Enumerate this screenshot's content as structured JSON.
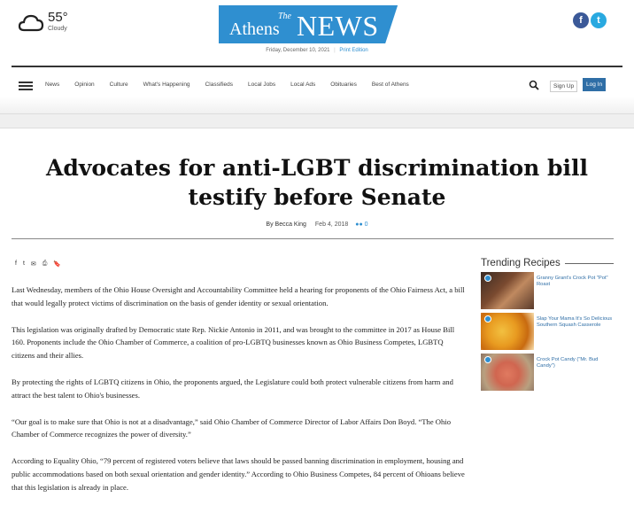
{
  "weather": {
    "temperature": "55°",
    "condition": "Cloudy",
    "icon": "cloud-icon"
  },
  "logo": {
    "the": "The",
    "athens": "Athens",
    "news": "NEWS"
  },
  "social": {
    "facebook_glyph": "f",
    "twitter_glyph": "t"
  },
  "dateline": {
    "date": "Friday, December 10, 2021",
    "separator": "|",
    "print_edition": "Print Edition"
  },
  "nav": {
    "items": [
      "News",
      "Opinion",
      "Culture",
      "What's Happening",
      "Classifieds",
      "Local Jobs",
      "Local Ads",
      "Obituaries",
      "Best of Athens"
    ],
    "signup": "Sign Up",
    "login": "Log In"
  },
  "article": {
    "headline_line1": "Advocates for anti-LGBT discrimination bill",
    "headline_line2": "testify before Senate",
    "byline": "By Becca King",
    "date": "Feb 4, 2018",
    "comments": "0",
    "tools": [
      "f",
      "t",
      "✉",
      "⎙",
      "🔖"
    ],
    "paragraphs": [
      "Last Wednesday, members of the Ohio House Oversight and Accountability Committee held a hearing for proponents of the Ohio Fairness Act, a bill that would legally protect victims of discrimination on the basis of gender identity or sexual orientation.",
      "This legislation was originally drafted by Democratic state Rep. Nickie Antonio in 2011, and was brought to the committee in 2017 as House Bill 160.  Proponents include the Ohio Chamber of Commerce, a coalition of pro-LGBTQ businesses known as Ohio Business Competes, LGBTQ citizens and their allies.",
      "By protecting the rights of LGBTQ citizens in Ohio, the proponents argued, the Legislature could both protect vulnerable citizens from harm and attract the best talent to Ohio's businesses.",
      "“Our goal is to make sure that Ohio is not at a disadvantage,” said Ohio Chamber of Commerce Director of Labor Affairs Don Boyd.  “The Ohio Chamber of Commerce recognizes the power of diversity.”",
      "According to Equality Ohio, “79 percent of registered voters believe that laws should be passed banning discrimination in employment, housing and public accommodations based on both sexual orientation and gender identity.”  According to Ohio Business Competes, 84 percent of Ohioans believe that this legislation is already in place."
    ]
  },
  "trending": {
    "title": "Trending Recipes",
    "items": [
      {
        "caption": "Granny Grant's Crock Pot \"Pot\" Roast"
      },
      {
        "caption": "Slap Your Mama It's So Delicious Southern Squash Casserole"
      },
      {
        "caption": "Crock Pot Candy (\"Mr. Bud Candy\")"
      }
    ]
  }
}
